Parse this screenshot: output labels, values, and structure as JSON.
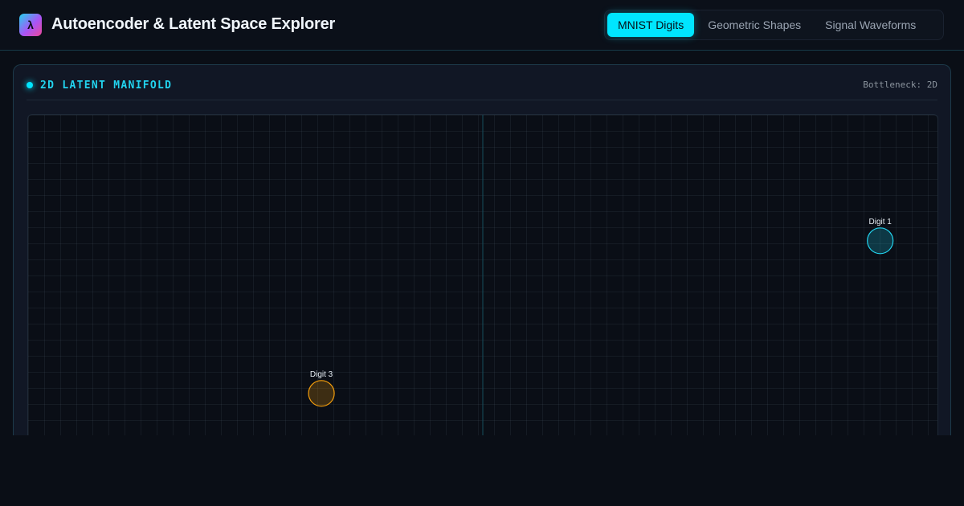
{
  "header": {
    "logo_glyph": "λ",
    "title": "Autoencoder & Latent Space Explorer",
    "tabs": [
      {
        "label": "MNIST Digits",
        "active": true
      },
      {
        "label": "Geometric Shapes",
        "active": false
      },
      {
        "label": "Signal Waveforms",
        "active": false
      }
    ]
  },
  "panel": {
    "title": "2D LATENT MANIFOLD",
    "bottleneck": "Bottleneck: 2D"
  },
  "manifold": {
    "x_range": [
      -1,
      1
    ],
    "y_range": [
      -1,
      1
    ],
    "points": [
      {
        "label": "Digit 1",
        "x": 0.874,
        "y": 0.608,
        "color": "#22d3ee"
      },
      {
        "label": "Digit 3",
        "x": -0.355,
        "y": 0.133,
        "color": "#f59e0b"
      }
    ]
  },
  "colors": {
    "accent": "#00e5ff",
    "background": "#0a0e16"
  }
}
